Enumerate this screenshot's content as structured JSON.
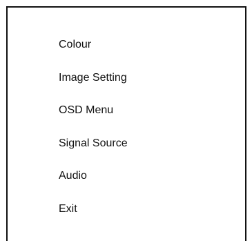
{
  "menu": {
    "items": [
      {
        "label": "Colour"
      },
      {
        "label": "Image Setting"
      },
      {
        "label": "OSD Menu"
      },
      {
        "label": "Signal Source"
      },
      {
        "label": "Audio"
      },
      {
        "label": "Exit"
      }
    ]
  }
}
